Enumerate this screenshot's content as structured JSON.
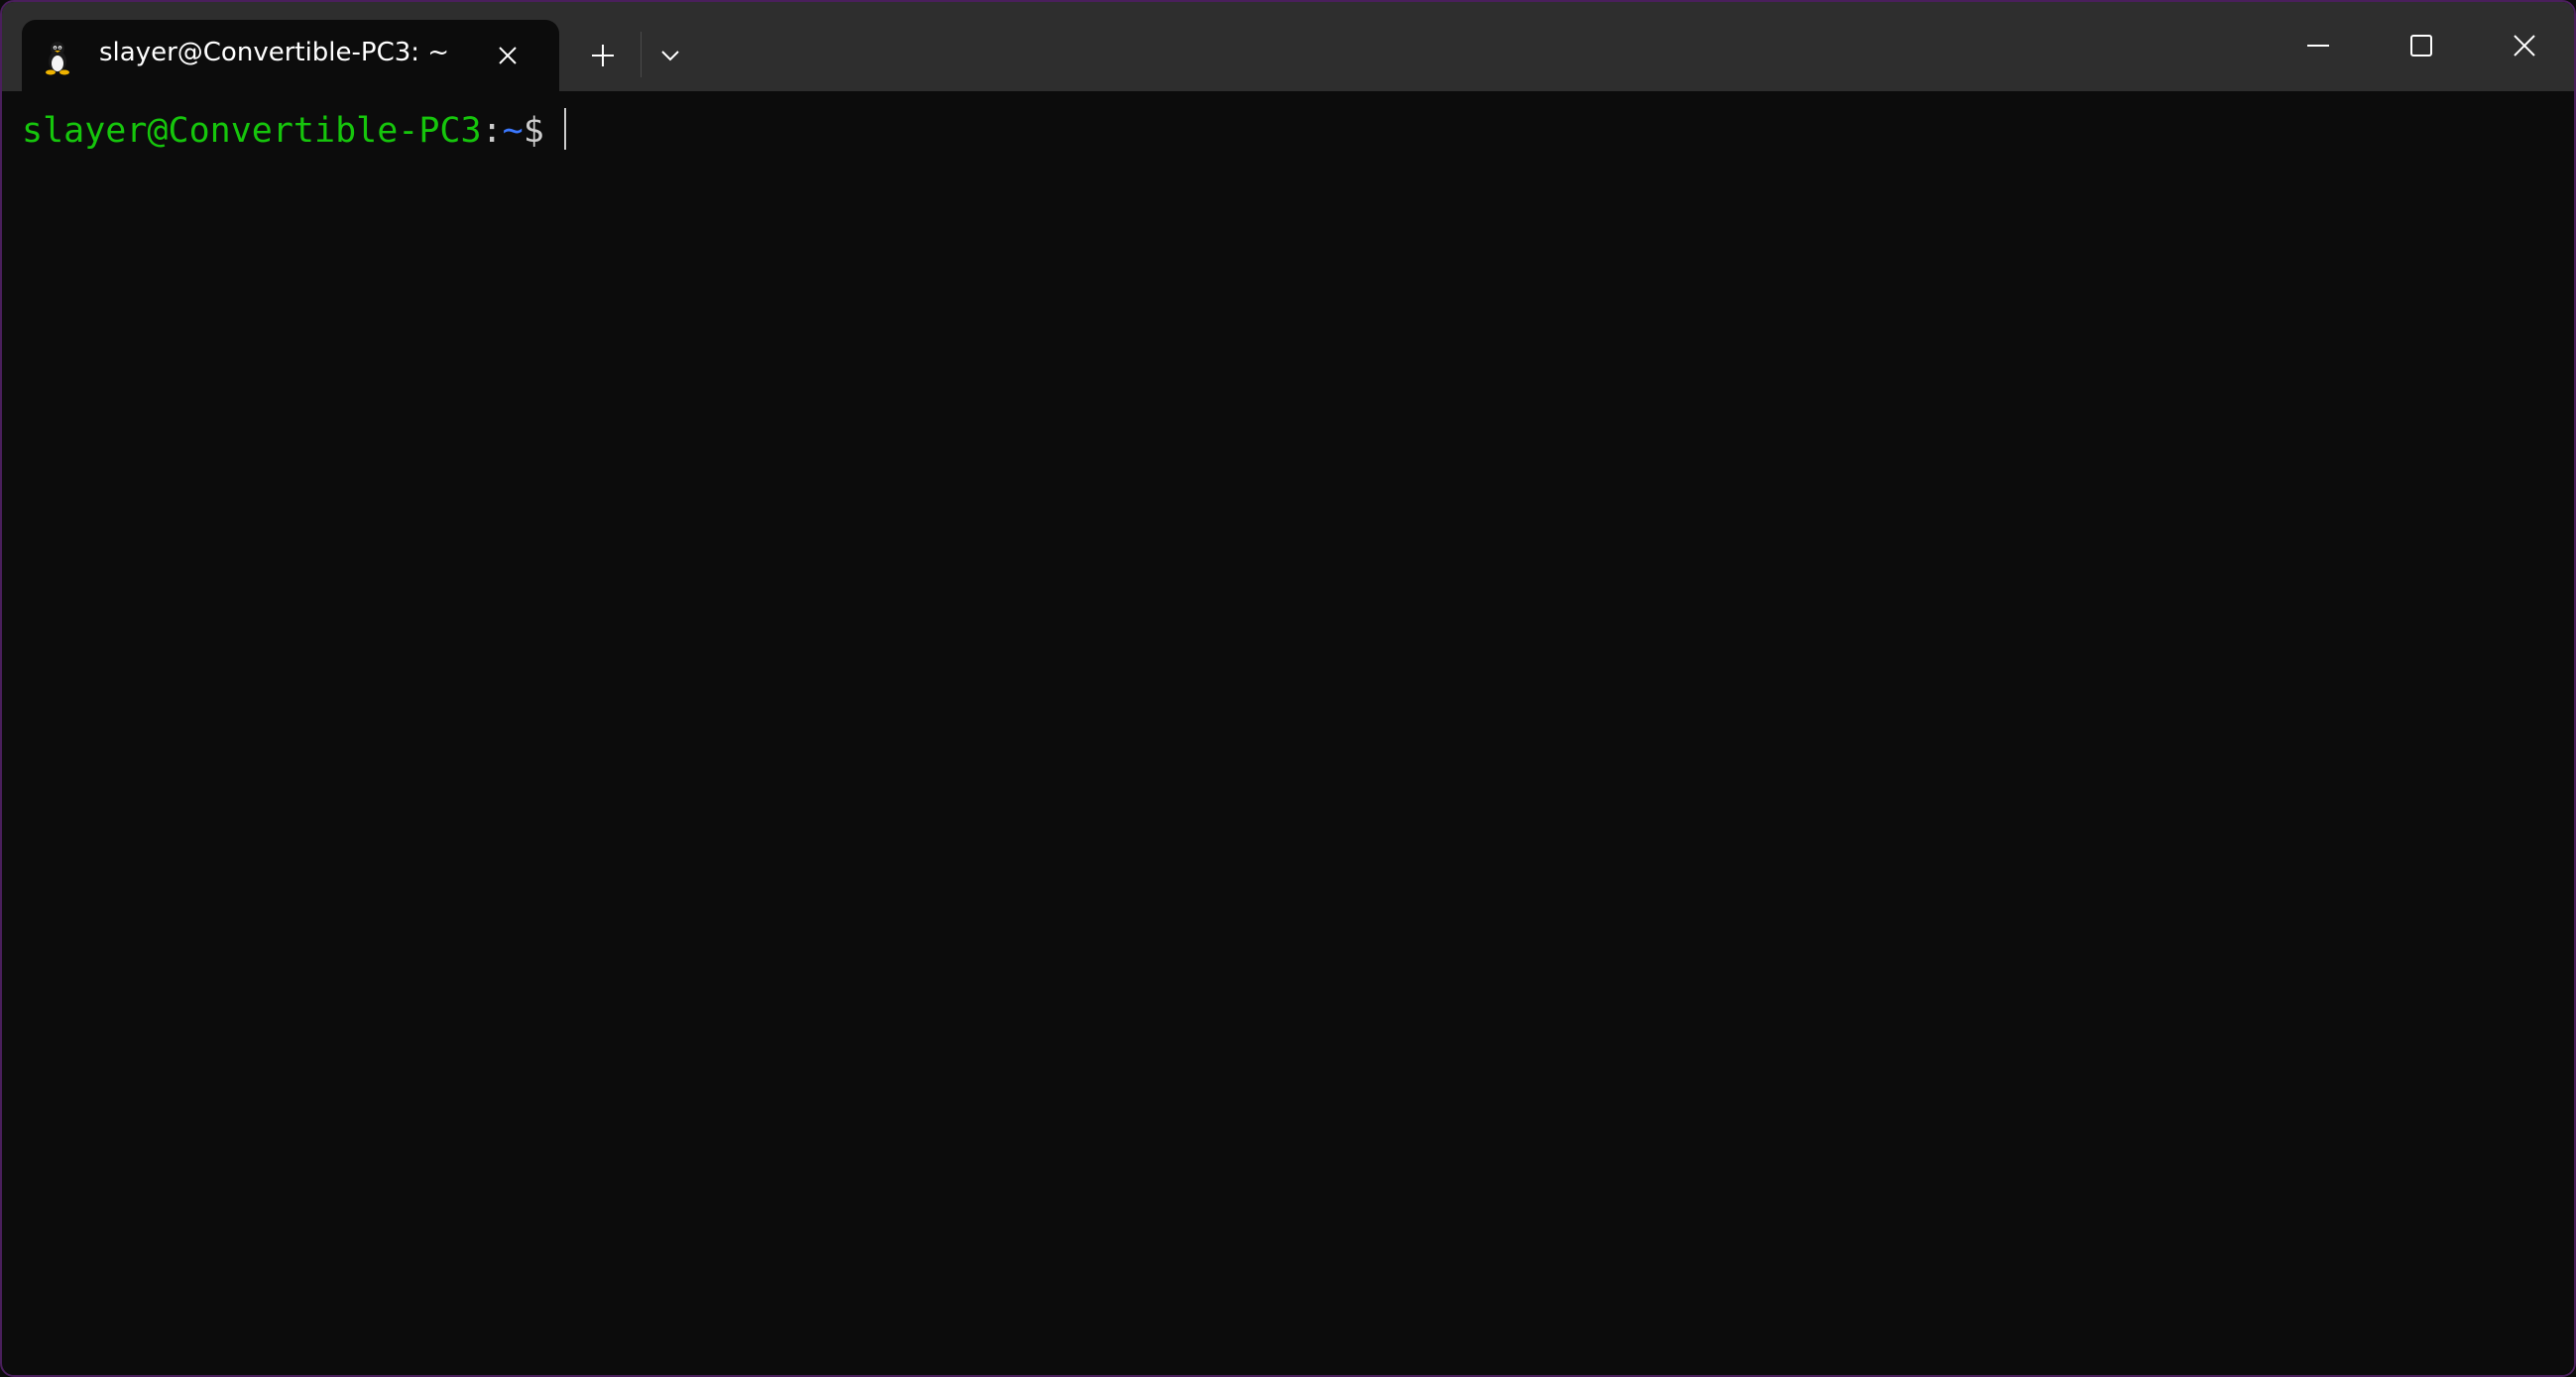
{
  "window": {
    "tab_title": "slayer@Convertible-PC3: ~",
    "tab_icon": "linux-tux-icon",
    "border_color": "#4a1f5c"
  },
  "toolbar": {
    "new_tab_icon": "plus-icon",
    "dropdown_icon": "chevron-down-icon",
    "close_tab_icon": "close-icon"
  },
  "window_controls": {
    "minimize_icon": "minimize-icon",
    "maximize_icon": "maximize-icon",
    "close_icon": "close-icon"
  },
  "terminal": {
    "user_host": "slayer@Convertible-PC3",
    "colon": ":",
    "path": "~",
    "dollar": "$",
    "colors": {
      "user_host": "#16c60c",
      "path": "#3b78ff",
      "text": "#cccccc",
      "background": "#0c0c0c"
    }
  }
}
